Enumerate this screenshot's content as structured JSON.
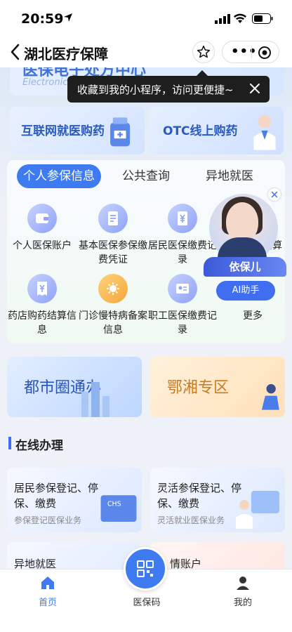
{
  "status": {
    "time": "20:59"
  },
  "nav": {
    "title": "湖北医疗保障"
  },
  "banner": {
    "title_partial": "医保电子处方中心",
    "subtitle_partial": "Electronic p"
  },
  "tooltip": {
    "text": "收藏到我的小程序，访问更便捷~"
  },
  "promo_cards": [
    {
      "label": "互联网就医购药"
    },
    {
      "label": "OTC线上购药"
    }
  ],
  "tabs": [
    {
      "label": "个人参保信息",
      "active": true
    },
    {
      "label": "公共查询",
      "active": false
    },
    {
      "label": "异地就医",
      "active": false
    }
  ],
  "services": [
    {
      "label": "个人医保账户",
      "icon": "wallet-icon"
    },
    {
      "label": "基本医保参保缴费凭证",
      "icon": "document-icon"
    },
    {
      "label": "居民医保缴费记录",
      "icon": "yuan-icon"
    },
    {
      "label": "个人医保结算",
      "icon": "receipt-icon"
    },
    {
      "label": "药店购药结算信息",
      "icon": "receipt-icon"
    },
    {
      "label": "门诊慢特病备案信息",
      "icon": "virus-icon"
    },
    {
      "label": "职工医保缴费记录",
      "icon": "id-card-icon"
    },
    {
      "label": "更多",
      "icon": "more-icon"
    }
  ],
  "assistant": {
    "name": "依保儿",
    "button": "AI助手"
  },
  "feature_cards": [
    {
      "label": "都市圈通办"
    },
    {
      "label": "鄂湘专区"
    }
  ],
  "section": {
    "title": "在线办理"
  },
  "online_cards": [
    {
      "title": "居民参保登记、停保、缴费",
      "subtitle": "参保登记医保业务"
    },
    {
      "title": "灵活参保登记、停保、缴费",
      "subtitle": "灵活就业医保业务"
    }
  ],
  "mini_cards": [
    {
      "title": "异地就医"
    },
    {
      "title": "情账户"
    }
  ],
  "tabbar": {
    "home": "首页",
    "qr": "医保码",
    "mine": "我的"
  },
  "colors": {
    "accent": "#3f7bf0",
    "brand_text": "#2a55b7"
  }
}
